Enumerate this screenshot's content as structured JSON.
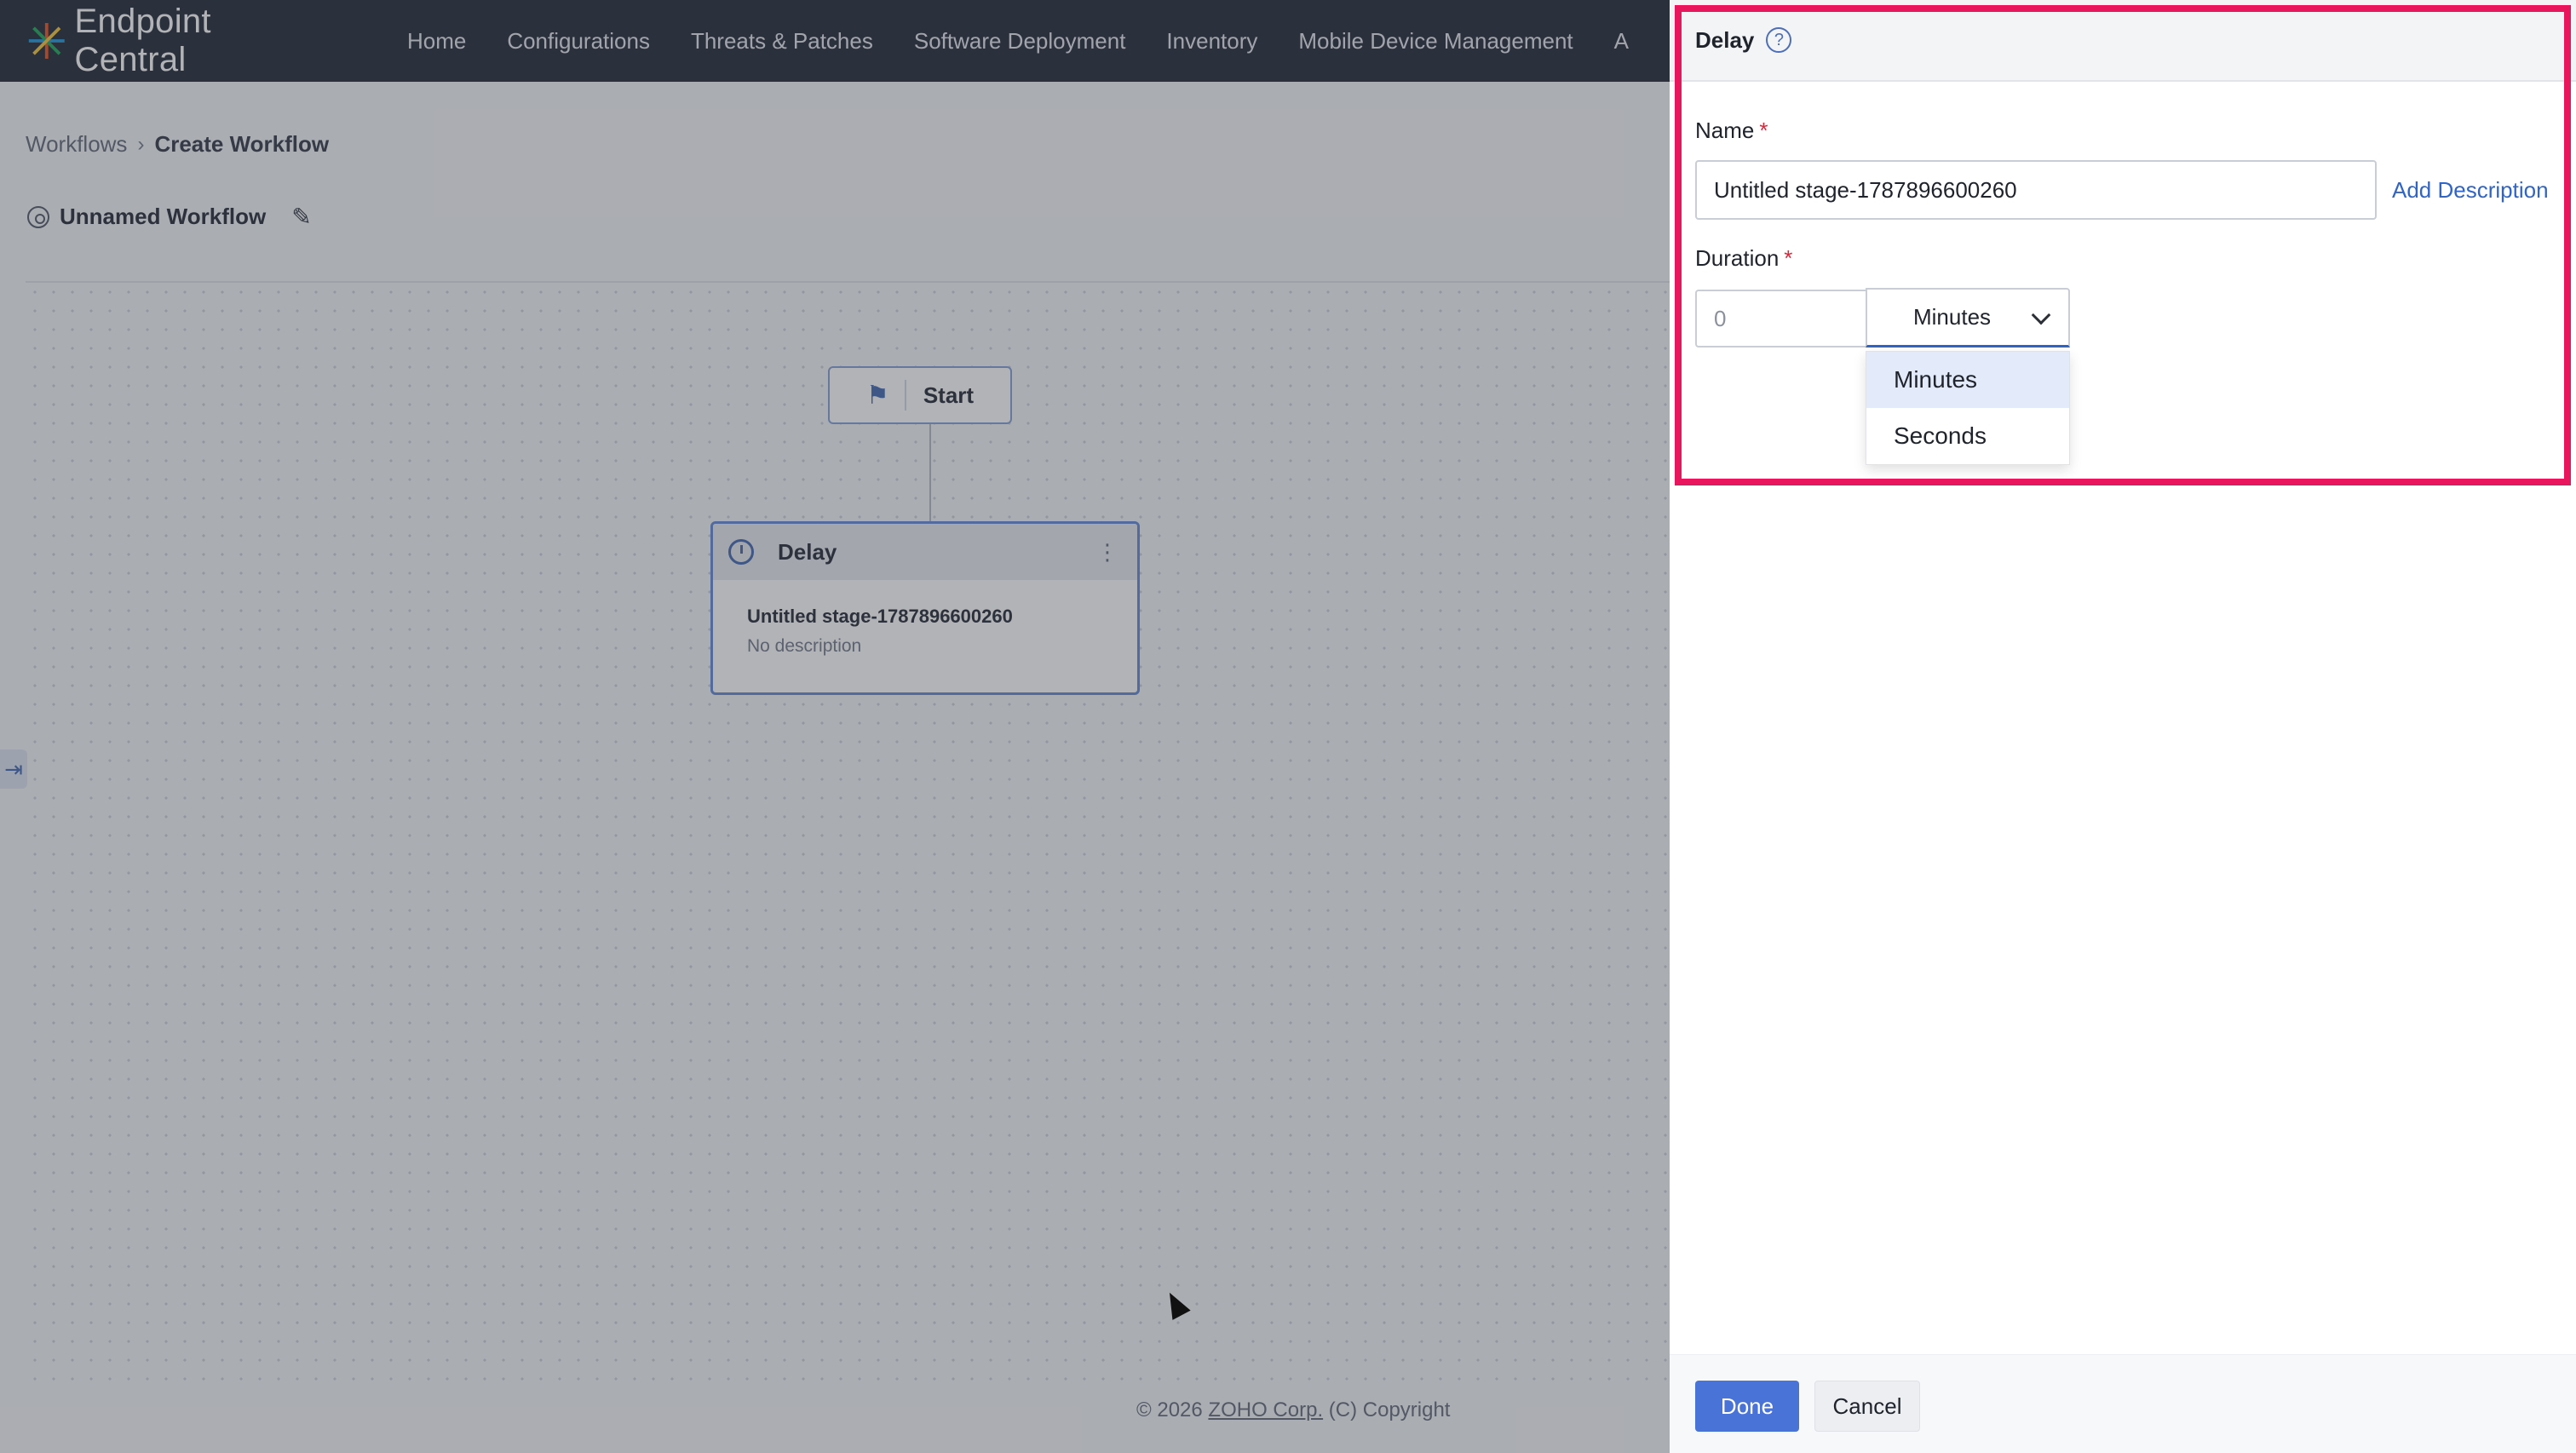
{
  "app": {
    "brand": "Endpoint Central",
    "nav": [
      "Home",
      "Configurations",
      "Threats & Patches",
      "Software Deployment",
      "Inventory",
      "Mobile Device Management",
      "A"
    ]
  },
  "breadcrumb": {
    "parent": "Workflows",
    "current": "Create Workflow"
  },
  "workflow": {
    "name": "Unnamed Workflow"
  },
  "canvas": {
    "start_label": "Start",
    "delay_node": {
      "title": "Delay",
      "stage_name": "Untitled stage-1787896600260",
      "description": "No description"
    }
  },
  "footer": {
    "prefix": "© 2026 ",
    "corp": "ZOHO Corp.",
    "suffix": " (C) Copyright"
  },
  "panel": {
    "title": "Delay",
    "help_glyph": "?",
    "name_label": "Name",
    "name_value": "Untitled stage-1787896600260",
    "add_description": "Add Description",
    "duration_label": "Duration",
    "duration_placeholder": "0",
    "unit_selected": "Minutes",
    "unit_options": [
      "Minutes",
      "Seconds"
    ],
    "required_mark": "*",
    "done_label": "Done",
    "cancel_label": "Cancel"
  },
  "colors": {
    "accent": "#4a73d8",
    "highlight": "#e8175d",
    "topbar": "#2c3240"
  }
}
